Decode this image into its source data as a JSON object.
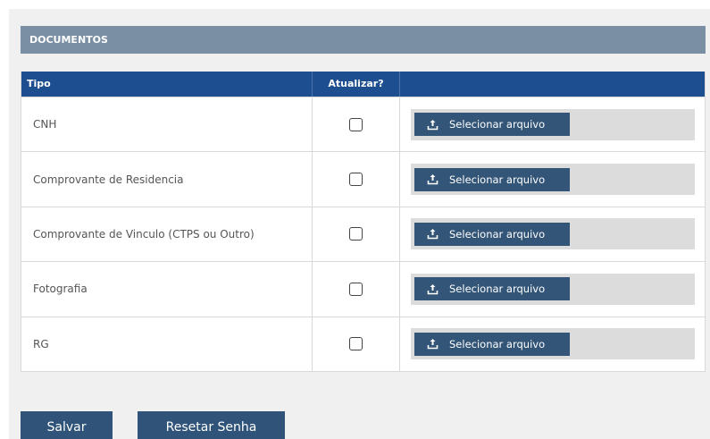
{
  "section": {
    "title": "DOCUMENTOS"
  },
  "table": {
    "headers": {
      "tipo": "Tipo",
      "atualizar": "Atualizar?",
      "arquivo": ""
    },
    "rows": [
      {
        "tipo": "CNH",
        "atualizar": false,
        "button_label": "Selecionar arquivo"
      },
      {
        "tipo": "Comprovante de Residencia",
        "atualizar": false,
        "button_label": "Selecionar arquivo"
      },
      {
        "tipo": "Comprovante de Vinculo (CTPS ou Outro)",
        "atualizar": false,
        "button_label": "Selecionar arquivo"
      },
      {
        "tipo": "Fotografia",
        "atualizar": false,
        "button_label": "Selecionar arquivo"
      },
      {
        "tipo": "RG",
        "atualizar": false,
        "button_label": "Selecionar arquivo"
      }
    ]
  },
  "actions": {
    "save_label": "Salvar",
    "reset_label": "Resetar Senha"
  },
  "icons": {
    "upload": "upload-icon"
  },
  "colors": {
    "section_header": "#7a8fa3",
    "table_header": "#1d4e8f",
    "button": "#335577"
  }
}
